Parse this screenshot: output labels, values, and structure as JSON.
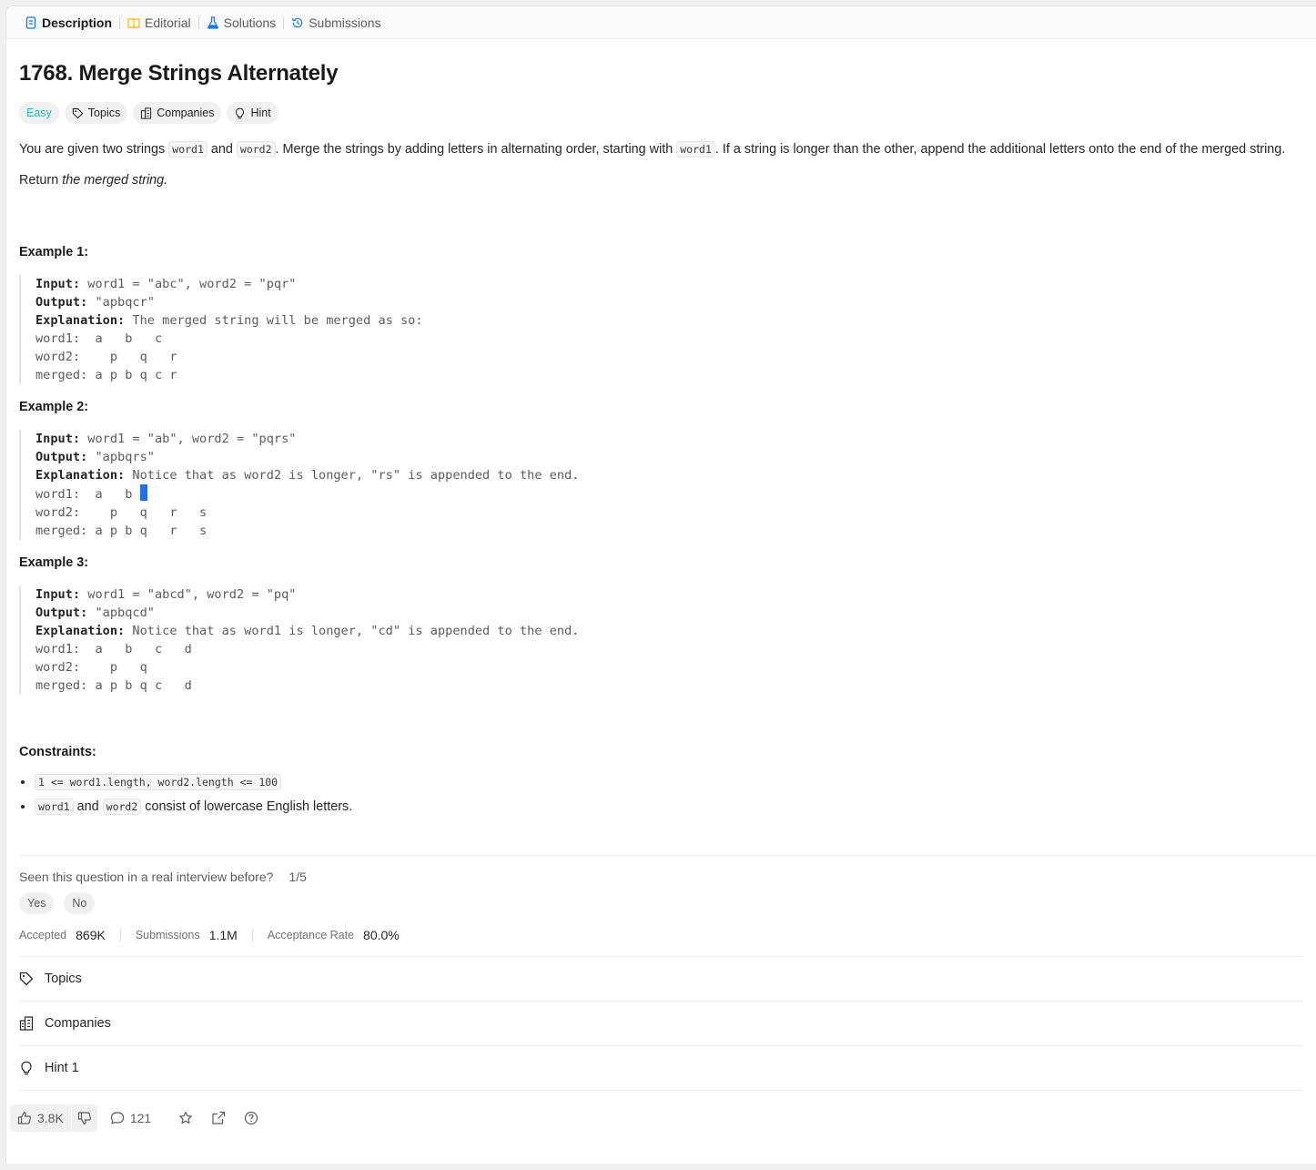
{
  "tabs": [
    {
      "label": "Description",
      "icon": "description-icon",
      "active": true
    },
    {
      "label": "Editorial",
      "icon": "book-icon"
    },
    {
      "label": "Solutions",
      "icon": "flask-icon"
    },
    {
      "label": "Submissions",
      "icon": "history-icon"
    }
  ],
  "problem": {
    "title": "1768. Merge Strings Alternately",
    "difficulty": "Easy",
    "pills": {
      "topics": "Topics",
      "companies": "Companies",
      "hint": "Hint"
    },
    "desc": {
      "p1": "You are given two strings ",
      "c1": "word1",
      "p2": " and ",
      "c2": "word2",
      "p3": ". Merge the strings by adding letters in alternating order, starting with ",
      "c3": "word1",
      "p4": ". If a string is longer than the other, append the additional letters onto the end of the merged string."
    },
    "return": {
      "prefix": "Return ",
      "emph": "the merged string."
    }
  },
  "examples": [
    {
      "title": "Example 1:",
      "input_label": "Input:",
      "input": " word1 = \"abc\", word2 = \"pqr\"",
      "output_label": "Output:",
      "output": " \"apbqcr\"",
      "expl_label": "Explanation:",
      "expl": " The merged string will be merged as so:",
      "lines": [
        "word1:  a   b   c",
        "word2:    p   q   r",
        "merged: a p b q c r"
      ]
    },
    {
      "title": "Example 2:",
      "input_label": "Input:",
      "input": " word1 = \"ab\", word2 = \"pqrs\"",
      "output_label": "Output:",
      "output": " \"apbqrs\"",
      "expl_label": "Explanation:",
      "expl": " Notice that as word2 is longer, \"rs\" is appended to the end.",
      "lines": [
        "word1:  a   b ",
        "word2:    p   q   r   s",
        "merged: a p b q   r   s"
      ]
    },
    {
      "title": "Example 3:",
      "input_label": "Input:",
      "input": " word1 = \"abcd\", word2 = \"pq\"",
      "output_label": "Output:",
      "output": " \"apbqcd\"",
      "expl_label": "Explanation:",
      "expl": " Notice that as word1 is longer, \"cd\" is appended to the end.",
      "lines": [
        "word1:  a   b   c   d",
        "word2:    p   q",
        "merged: a p b q c   d"
      ]
    }
  ],
  "constraints": {
    "title": "Constraints:",
    "c1": "1 <= word1.length, word2.length <= 100",
    "c2_code1": "word1",
    "c2_and": " and ",
    "c2_code2": "word2",
    "c2_text": " consist of lowercase English letters."
  },
  "interview": {
    "question": "Seen this question in a real interview before?",
    "count": "1/5",
    "yes": "Yes",
    "no": "No"
  },
  "stats": {
    "accepted_label": "Accepted",
    "accepted": "869K",
    "submissions_label": "Submissions",
    "submissions": "1.1M",
    "rate_label": "Acceptance Rate",
    "rate": "80.0%"
  },
  "sections": {
    "topics": "Topics",
    "companies": "Companies",
    "hint": "Hint 1"
  },
  "bottom": {
    "likes": "3.8K",
    "comments": "121"
  },
  "colors": {
    "easy": "#1cbaba",
    "cursor": "#1a73e8",
    "editorial_icon": "#ffb800",
    "solutions_icon": "#1a73e8"
  }
}
